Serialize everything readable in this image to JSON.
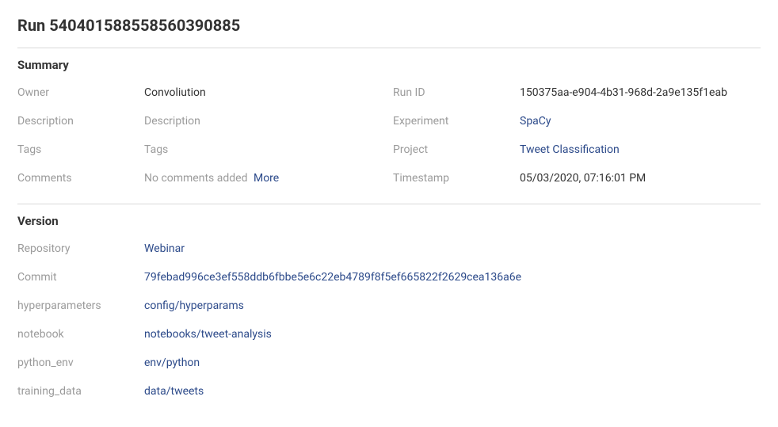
{
  "title": "Run 540401588558560390885",
  "sections": {
    "summary": {
      "heading": "Summary",
      "owner_label": "Owner",
      "owner_value": "Convoliution",
      "runid_label": "Run ID",
      "runid_value": "150375aa-e904-4b31-968d-2a9e135f1eab",
      "description_label": "Description",
      "description_placeholder": "Description",
      "experiment_label": "Experiment",
      "experiment_value": "SpaCy",
      "tags_label": "Tags",
      "tags_placeholder": "Tags",
      "project_label": "Project",
      "project_value": "Tweet Classification",
      "comments_label": "Comments",
      "comments_value": "No comments added",
      "comments_more": "More",
      "timestamp_label": "Timestamp",
      "timestamp_value": "05/03/2020, 07:16:01 PM"
    },
    "version": {
      "heading": "Version",
      "repository_label": "Repository",
      "repository_value": "Webinar",
      "commit_label": "Commit",
      "commit_value": "79febad996ce3ef558ddb6fbbe5e6c22eb4789f8f5ef665822f2629cea136a6e",
      "hyperparameters_label": "hyperparameters",
      "hyperparameters_value": "config/hyperparams",
      "notebook_label": "notebook",
      "notebook_value": "notebooks/tweet-analysis",
      "python_env_label": "python_env",
      "python_env_value": "env/python",
      "training_data_label": "training_data",
      "training_data_value": "data/tweets"
    }
  }
}
